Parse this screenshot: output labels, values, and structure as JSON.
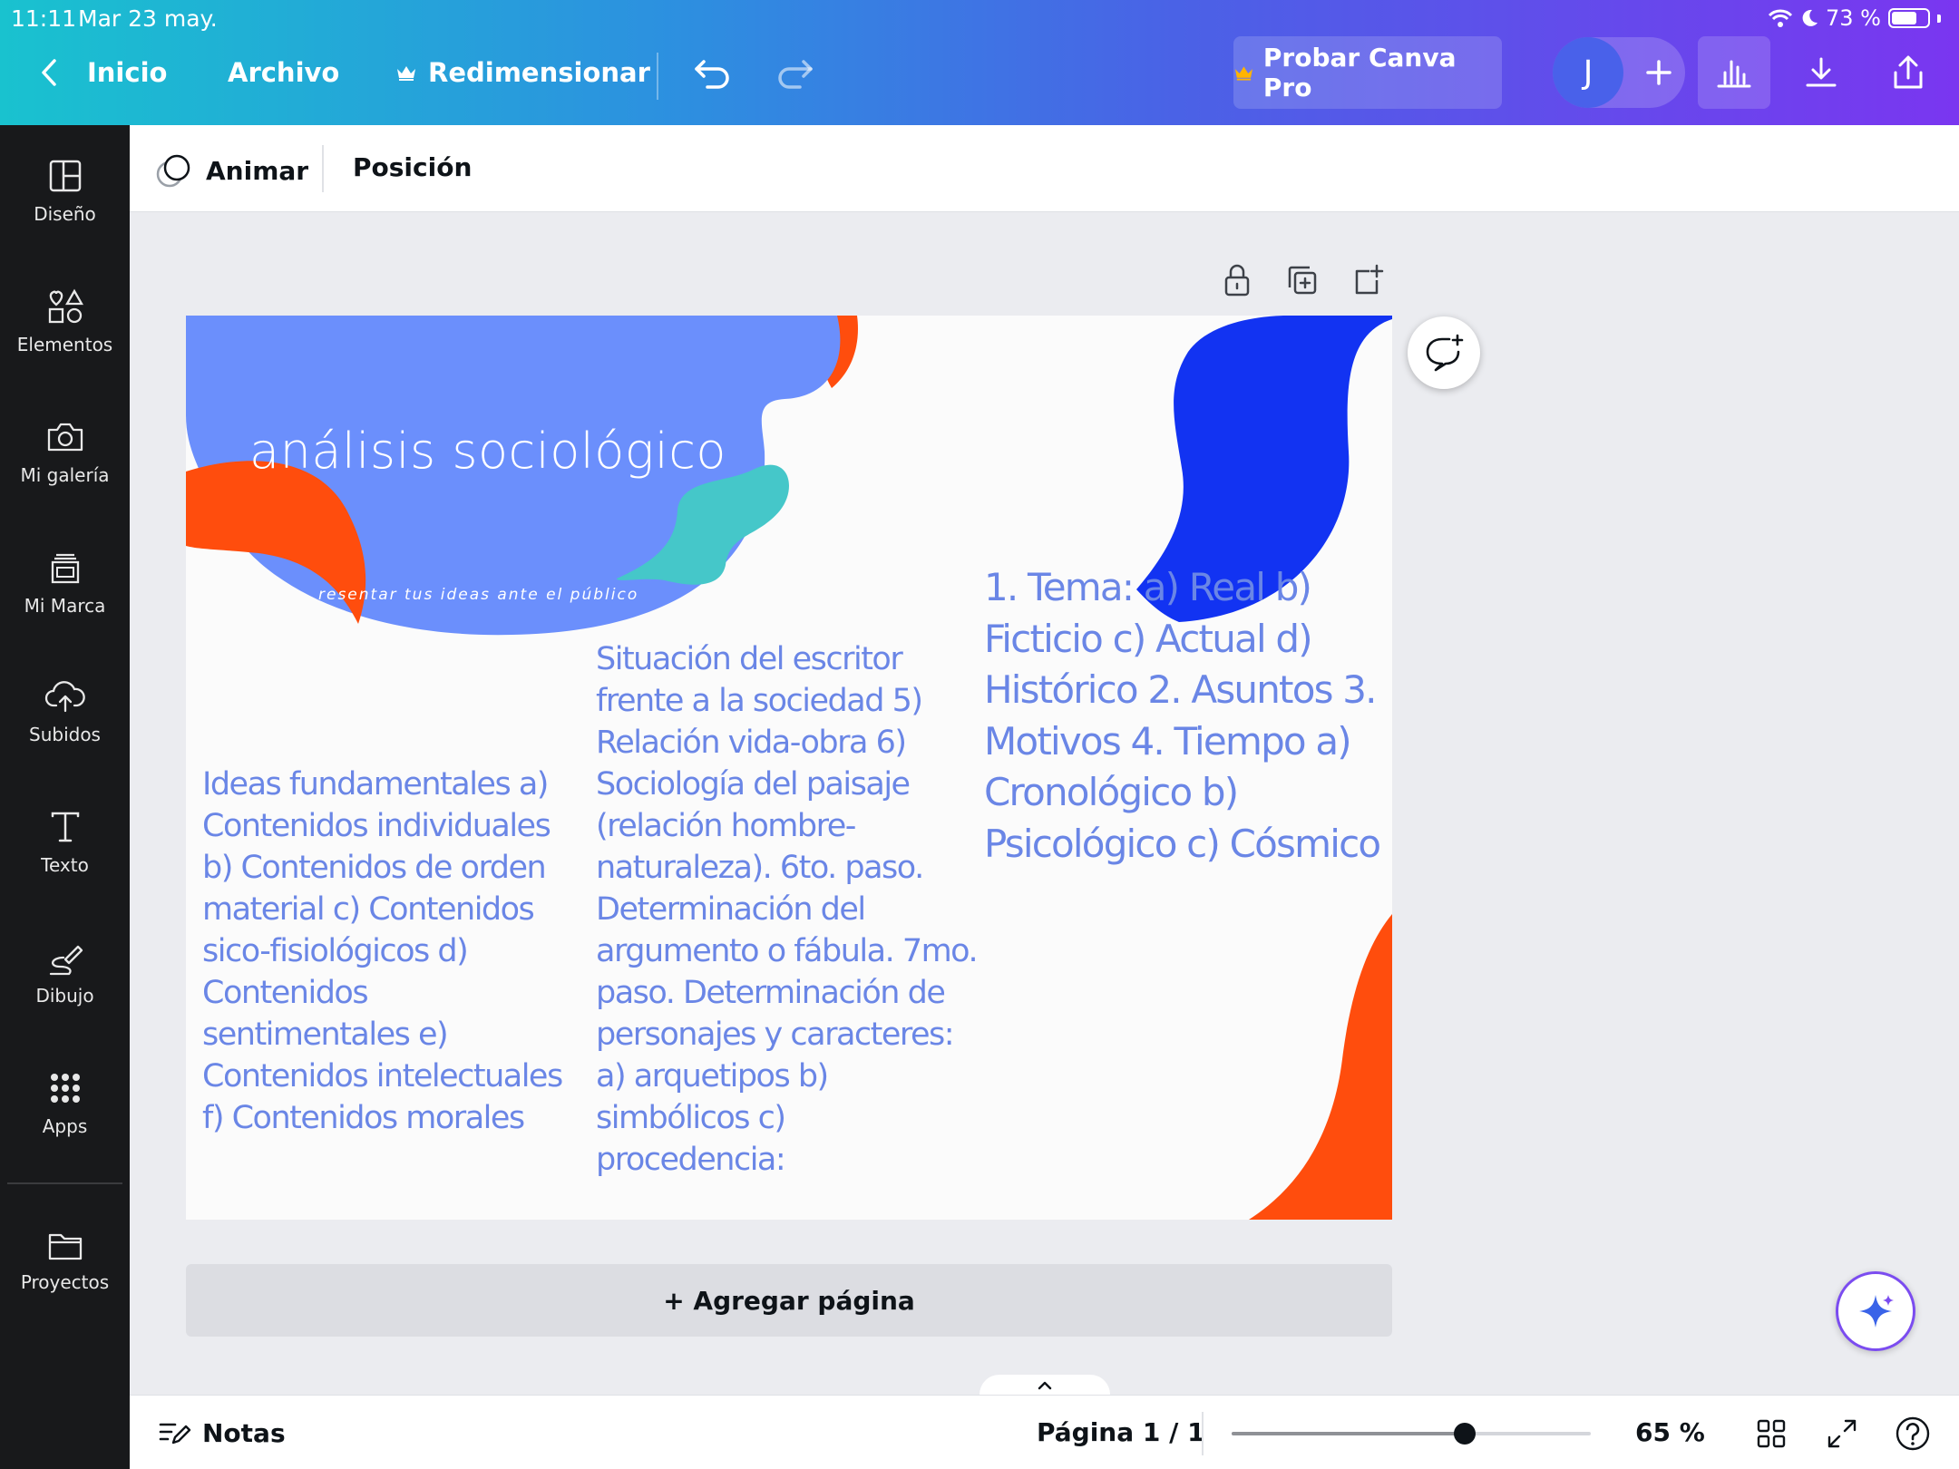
{
  "status_bar": {
    "time": "11:11",
    "date": "Mar 23 may.",
    "battery": "73 %",
    "battery_level": 0.73
  },
  "topbar": {
    "back_label": "Inicio",
    "file_label": "Archivo",
    "resize_label": "Redimensionar",
    "pro_label": "Probar Canva Pro",
    "avatar_initial": "J"
  },
  "sidebar": {
    "items": [
      {
        "label": "Diseño",
        "icon": "layout-icon"
      },
      {
        "label": "Elementos",
        "icon": "shapes-icon"
      },
      {
        "label": "Mi galería",
        "icon": "camera-icon"
      },
      {
        "label": "Mi Marca",
        "icon": "brand-icon"
      },
      {
        "label": "Subidos",
        "icon": "cloud-upload-icon"
      },
      {
        "label": "Texto",
        "icon": "text-icon"
      },
      {
        "label": "Dibujo",
        "icon": "draw-icon"
      },
      {
        "label": "Apps",
        "icon": "apps-grid-icon"
      },
      {
        "label": "Proyectos",
        "icon": "folder-icon"
      }
    ]
  },
  "toolbar": {
    "animate_label": "Animar",
    "position_label": "Posición"
  },
  "slide": {
    "title": "análisis sociológico",
    "subtitle": "resentar tus ideas ante el público",
    "col1": "Ideas fundamentales a) Contenidos individuales b) Contenidos de orden material c) Contenidos sico-fisiológicos d) Contenidos sentimentales e) Contenidos intelectuales f) Contenidos morales",
    "col2": "Situación del escritor frente a la sociedad 5) Relación vida-obra 6) Sociología del paisaje (relación hombre-naturaleza). 6to. paso. Determinación del argumento o fábula. 7mo. paso. Determinación de personajes y caracteres: a) arquetipos b) simbólicos c) procedencia:",
    "col3": "1. Tema: a) Real b) Ficticio c) Actual d) Histórico 2. Asuntos 3. Motivos 4. Tiempo a) Cronológico b) Psicológico c) Cósmico",
    "colors": {
      "text": "#6a86e6",
      "blob_light_blue": "#6b8ffc",
      "blob_dark_blue": "#1233f2",
      "blob_orange": "#ff4d0d",
      "blob_teal": "#45c7c9"
    }
  },
  "add_page_label": "+ Agregar página",
  "footer": {
    "notes_label": "Notas",
    "page_label": "Página 1 / 1",
    "zoom_label": "65 %",
    "zoom_level": 0.65
  }
}
